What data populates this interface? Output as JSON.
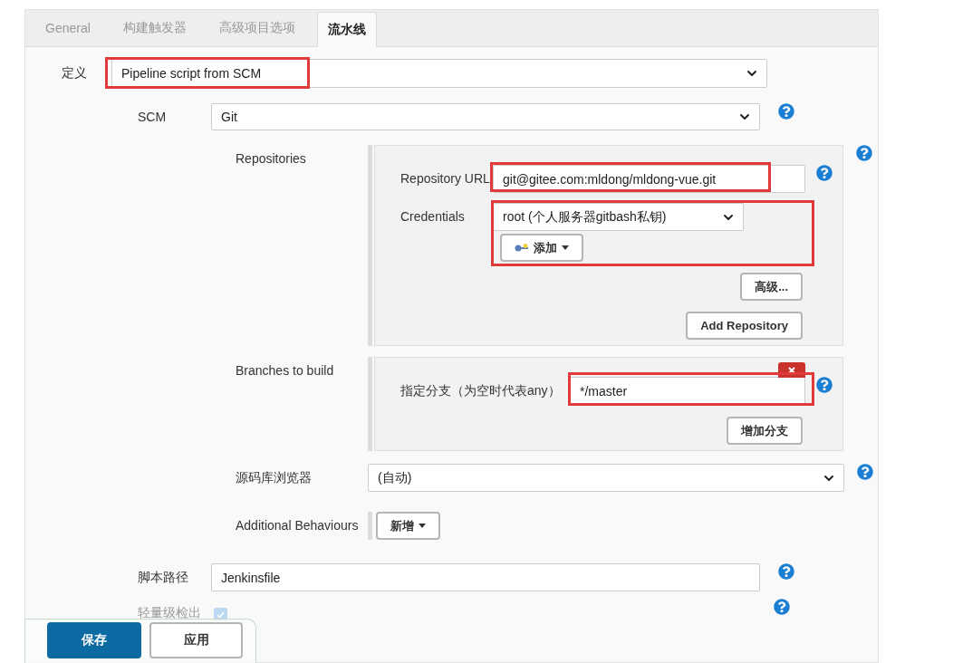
{
  "tabs": [
    {
      "label": "General",
      "selected": false
    },
    {
      "label": "构建触发器",
      "selected": false
    },
    {
      "label": "高级项目选项",
      "selected": false
    },
    {
      "label": "流水线",
      "selected": true
    }
  ],
  "definition": {
    "label": "定义",
    "value": "Pipeline script from SCM",
    "highlighted": true
  },
  "scm": {
    "label": "SCM",
    "value": "Git"
  },
  "repositories": {
    "label": "Repositories",
    "url": {
      "label": "Repository URL",
      "value": "git@gitee.com:mldong/mldong-vue.git",
      "highlighted": true
    },
    "credentials": {
      "label": "Credentials",
      "value": "root (个人服务器gitbash私钥)",
      "add_button": "添加",
      "highlighted": true
    },
    "advanced_button": "高级...",
    "add_button": "Add Repository"
  },
  "branches": {
    "label": "Branches to build",
    "branch": {
      "label": "指定分支（为空时代表any）",
      "value": "*/master",
      "highlighted": true
    },
    "add_button": "增加分支"
  },
  "browser": {
    "label": "源码库浏览器",
    "value": "(自动)"
  },
  "behaviours": {
    "label": "Additional Behaviours",
    "add_button": "新增"
  },
  "script_path": {
    "label": "脚本路径",
    "value": "Jenkinsfile"
  },
  "lightweight_checkout": {
    "label": "轻量级检出",
    "checked": true
  },
  "actions": {
    "save": "保存",
    "apply": "应用"
  }
}
